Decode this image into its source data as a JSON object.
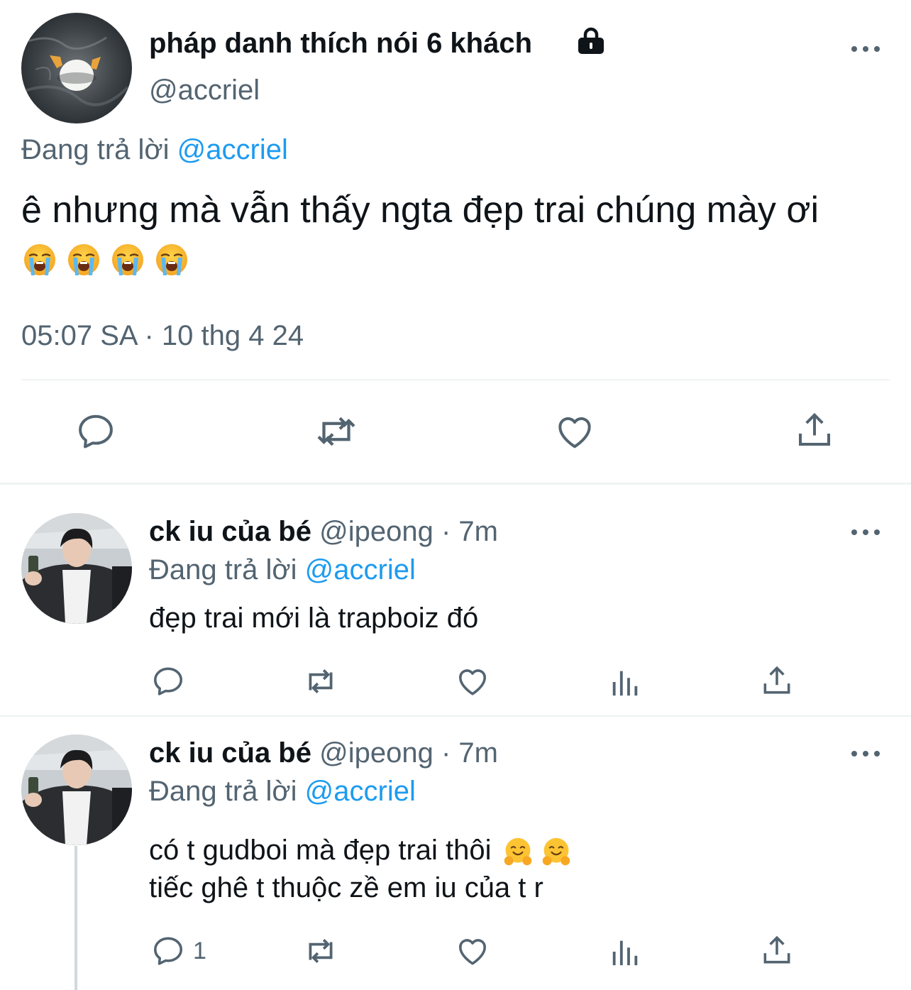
{
  "main_tweet": {
    "display_name": "pháp danh thích nói 6 khách",
    "handle": "@accriel",
    "replying_prefix": "Đang trả lời",
    "replying_to": "@accriel",
    "text": "ê nhưng mà vẫn thấy ngta đẹp trai chúng mày ơi",
    "emojis": [
      "loudly-crying-face",
      "loudly-crying-face",
      "loudly-crying-face",
      "loudly-crying-face"
    ],
    "timestamp": "05:07 SA · 10 thg 4 24",
    "actions": [
      "reply-icon",
      "retweet-icon",
      "like-icon",
      "share-icon"
    ]
  },
  "replies": [
    {
      "display_name": "ck iu của bé",
      "handle_time": "@ipeong · 7m",
      "replying_prefix": "Đang trả lời",
      "replying_to": "@accriel",
      "text_line1": "đẹp trai mới là trapboiz đó",
      "reply_count": "",
      "actions": [
        "reply-icon",
        "retweet-icon",
        "like-icon",
        "views-icon",
        "share-icon"
      ]
    },
    {
      "display_name": "ck iu của bé",
      "handle_time": "@ipeong · 7m",
      "replying_prefix": "Đang trả lời",
      "replying_to": "@accriel",
      "text_line1": "có t gudboi mà đẹp trai thôi",
      "line1_emojis": [
        "hugging-face",
        "hugging-face"
      ],
      "text_line2": "tiếc ghê t thuộc zề em iu của t r",
      "reply_count": "1",
      "actions": [
        "reply-icon",
        "retweet-icon",
        "like-icon",
        "views-icon",
        "share-icon"
      ]
    }
  ],
  "colors": {
    "text": "#0f1419",
    "muted": "#536471",
    "link": "#1d9bf0",
    "divider": "#eff3f4"
  }
}
